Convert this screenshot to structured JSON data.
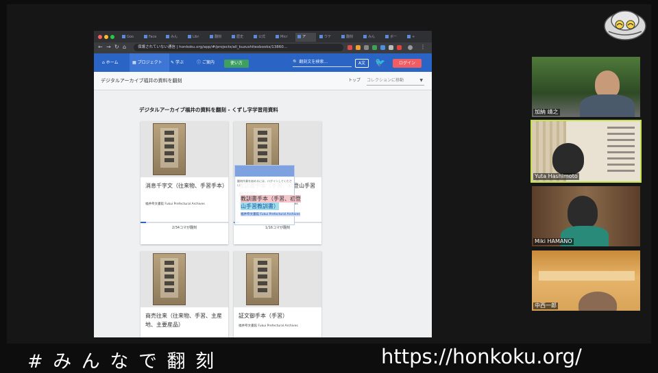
{
  "overlay_text": {
    "hashtag": "# み ん な で 翻 刻",
    "url": "https://honkoku.org/"
  },
  "browser": {
    "tabs": [
      "Goo",
      "Face",
      "みん",
      "Libr",
      "翻刻",
      "歴史",
      "公式",
      "Micr",
      "ア",
      "ウテ",
      "翻刻",
      "みん",
      "ボー",
      "+"
    ],
    "address": "保護されていない通信 | honkoku.org/app/#/projects/all_kuzushitexbooks/13860..."
  },
  "navbar": {
    "home": "ホーム",
    "project": "プロジェクト",
    "learn": "学ぶ",
    "about": "ご案内",
    "howto": "使い方",
    "search_placeholder": "翻刻文を検索...",
    "translate_icon_label": "A文",
    "login": "ログイン"
  },
  "subbar": {
    "title": "デジタルアーカイブ福井の資料を翻刻",
    "top": "トップ",
    "collection_select": "コレクションに移動"
  },
  "page": {
    "heading": "デジタルアーカイブ福井の資料を翻刻 - くずし字学習用資料"
  },
  "cards": [
    {
      "title": "消息千字文（往来物、手習手本）",
      "sub": "福井県文書館 Fukui Prefectural Archives",
      "count": "2/34コマが翻刻",
      "progress": 0.06
    },
    {
      "title": "教訓書手本（手習、初登山手習教訓書）",
      "sub": "福井県文書館 Fukui Prefectural Archives",
      "count": "1/16コマが翻刻",
      "progress": 0.06
    },
    {
      "title": "商売往来（往来物、手習、主産地、主要産品）",
      "sub": "",
      "count": "",
      "progress": 0
    },
    {
      "title": "証文御手本（手習）",
      "sub": "福井県文書館 Fukui Prefectural Archives",
      "count": "",
      "progress": 0
    }
  ],
  "popup": {
    "message": "翻刻作業を始めるには、ログインしてください",
    "hl1": "教訓書手本（手習、初登",
    "hl2": "山手習教訓書）",
    "hl3": "福井県文書館 Fukui Prefectural Archives"
  },
  "participants": [
    "加納 靖之",
    "Yuta Hashimoto",
    "Miki HAMANO",
    "中西一郎"
  ],
  "colors": {
    "navbar": "#2a65c6",
    "login": "#f25c63",
    "howto": "#3f9f5f"
  }
}
